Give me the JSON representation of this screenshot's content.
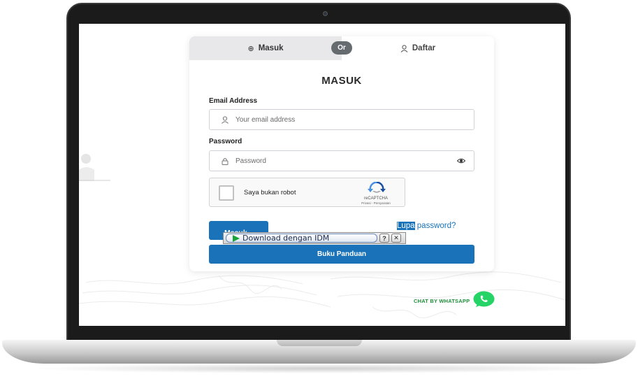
{
  "tabs": {
    "masuk_label": "Masuk",
    "or_label": "Or",
    "daftar_label": "Daftar"
  },
  "form": {
    "title": "MASUK",
    "email_label": "Email Address",
    "email_placeholder": "Your email address",
    "password_label": "Password",
    "password_placeholder": "Password"
  },
  "captcha": {
    "label": "Saya bukan robot",
    "brand": "reCAPTCHA",
    "terms": "Privasi - Persyaratan"
  },
  "buttons": {
    "login_label": "Masuk",
    "forgot_highlight": "Lupa",
    "forgot_rest": " password?",
    "guide_label": "Buku Panduan"
  },
  "idm": {
    "download_label": "Download dengan IDM",
    "help_label": "?",
    "close_label": "✕"
  },
  "whatsapp": {
    "label": "CHAT BY WHATSAPP"
  },
  "icons": {
    "tab_masuk": "login-icon",
    "tab_daftar": "user-icon",
    "email": "user-icon",
    "password": "lock-icon",
    "toggle": "eye-icon"
  },
  "colors": {
    "primary": "#1a73b8",
    "tab_bg": "#e8e8ea",
    "whatsapp": "#25d366"
  }
}
